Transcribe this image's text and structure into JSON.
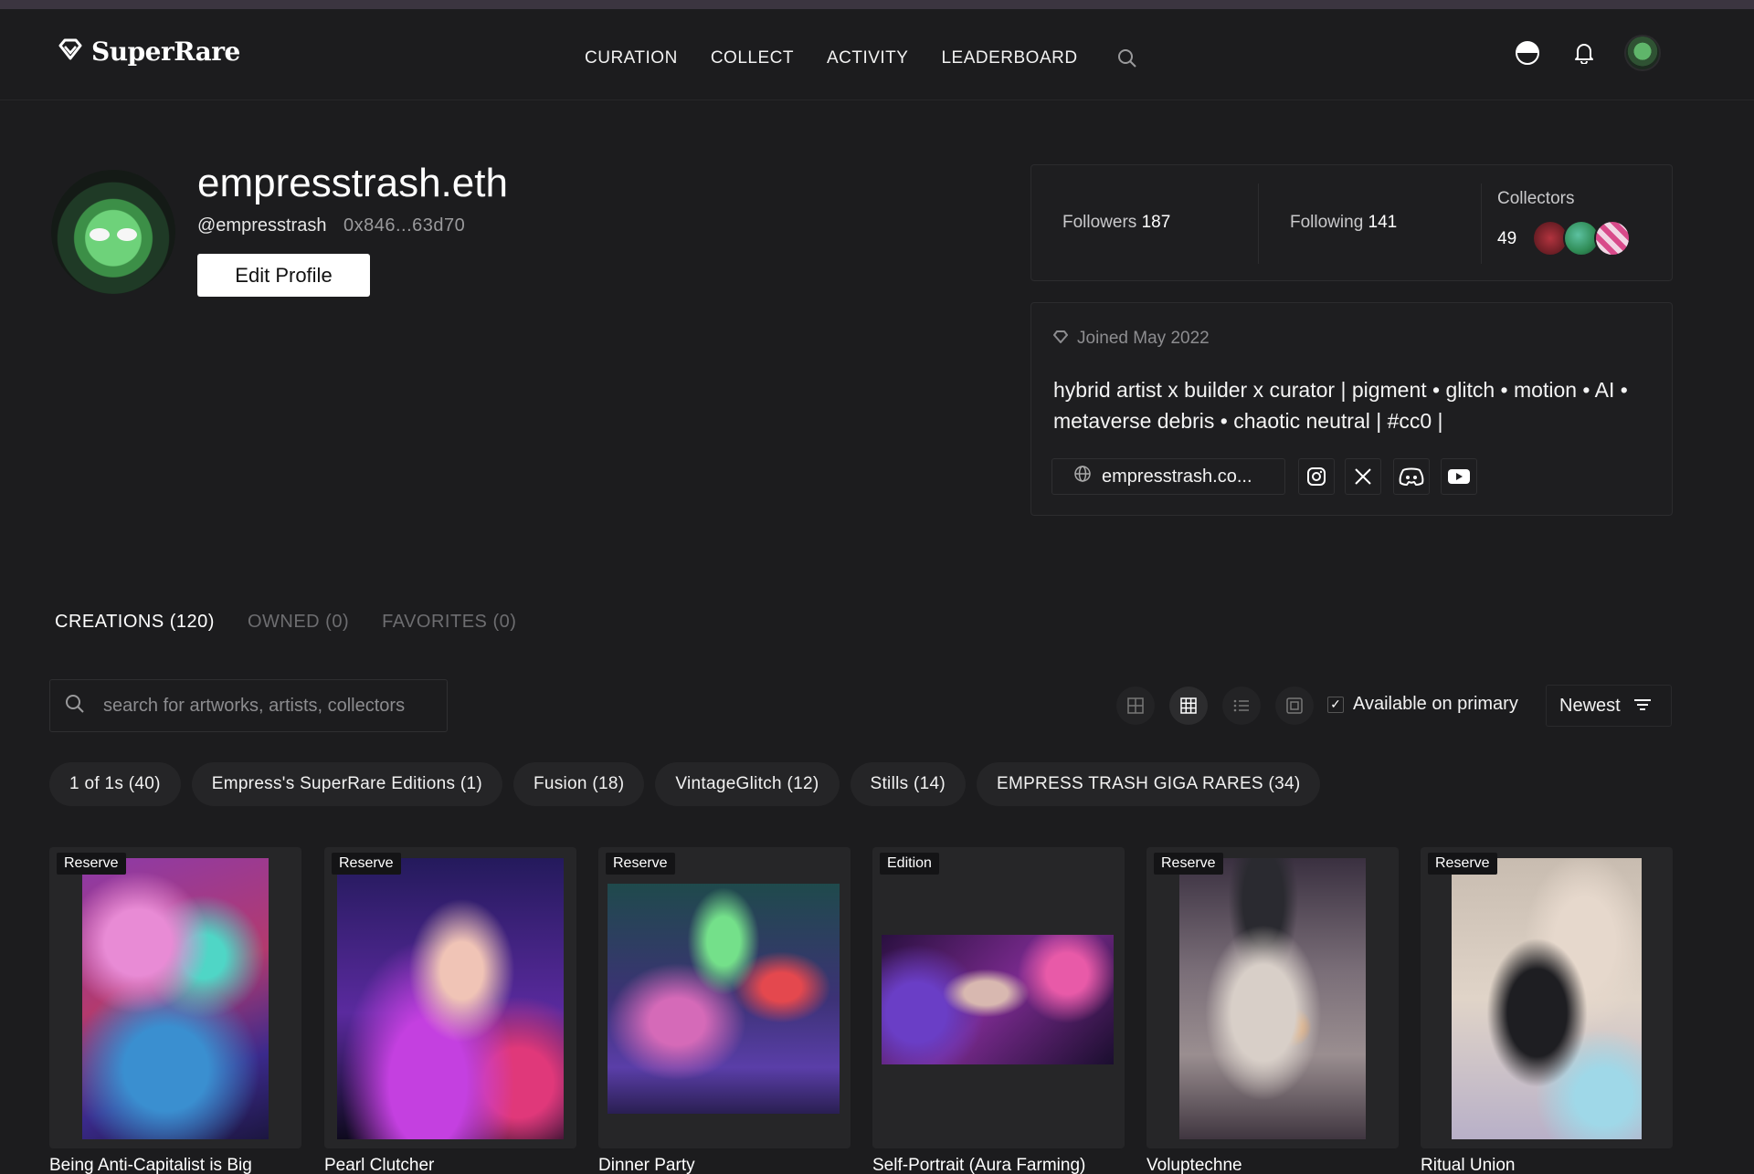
{
  "header": {
    "logo_text": "SuperRare",
    "nav": [
      "CURATION",
      "COLLECT",
      "ACTIVITY",
      "LEADERBOARD"
    ],
    "icons": [
      "search-icon",
      "theme-toggle-icon",
      "bell-icon",
      "avatar"
    ]
  },
  "profile": {
    "name": "empresstrash.eth",
    "handle": "@empresstrash",
    "address": "0x846...63d70",
    "edit_label": "Edit Profile"
  },
  "stats": {
    "followers_label": "Followers",
    "followers": "187",
    "following_label": "Following",
    "following": "141",
    "collectors_label": "Collectors",
    "collectors": "49"
  },
  "bio": {
    "joined": "Joined May 2022",
    "text": "hybrid artist x builder x curator | pigment • glitch • motion • AI • metaverse debris • chaotic neutral | #cc0 |",
    "website": "empresstrash.co...",
    "socials": [
      "instagram-icon",
      "x-icon",
      "discord-icon",
      "youtube-icon"
    ]
  },
  "tabs": [
    "CREATIONS (120)",
    "OWNED (0)",
    "FAVORITES (0)"
  ],
  "search": {
    "placeholder": "search for artworks, artists, collectors"
  },
  "controls": {
    "available_label": "Available on primary",
    "sort_label": "Newest"
  },
  "chips": [
    "1 of 1s (40)",
    "Empress's SuperRare Editions (1)",
    "Fusion (18)",
    "VintageGlitch (12)",
    "Stills (14)",
    "EMPRESS TRASH GIGA RARES (34)"
  ],
  "artworks": [
    {
      "badge": "Reserve",
      "title": "Being Anti-Capitalist is Big"
    },
    {
      "badge": "Reserve",
      "title": "Pearl Clutcher"
    },
    {
      "badge": "Reserve",
      "title": "Dinner Party"
    },
    {
      "badge": "Edition",
      "title": "Self-Portrait (Aura Farming)"
    },
    {
      "badge": "Reserve",
      "title": "Voluptechne"
    },
    {
      "badge": "Reserve",
      "title": "Ritual Union"
    }
  ]
}
